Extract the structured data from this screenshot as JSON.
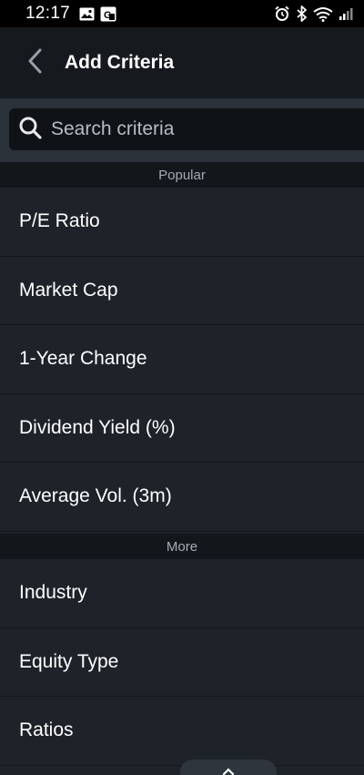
{
  "status_bar": {
    "time": "12:17",
    "left_icons": [
      "image-icon",
      "translate-icon"
    ],
    "right_icons": [
      "alarm-icon",
      "bluetooth-icon",
      "wifi-icon",
      "signal-icon"
    ]
  },
  "header": {
    "title": "Add Criteria",
    "back_icon": "chevron-left-icon"
  },
  "search": {
    "placeholder": "Search criteria",
    "value": ""
  },
  "sections": {
    "popular": {
      "title": "Popular",
      "items": [
        {
          "label": "P/E Ratio"
        },
        {
          "label": "Market Cap"
        },
        {
          "label": "1-Year Change"
        },
        {
          "label": "Dividend Yield (%)"
        },
        {
          "label": "Average Vol. (3m)"
        }
      ]
    },
    "more": {
      "title": "More",
      "items": [
        {
          "label": "Industry"
        },
        {
          "label": "Equity Type"
        },
        {
          "label": "Ratios"
        }
      ]
    }
  },
  "colors": {
    "background": "#1e2329",
    "header_bg": "#161a1f",
    "section_bg": "#13171c",
    "search_field_bg": "#0f1216",
    "text": "#ffffff",
    "muted_text": "#a5abb3"
  }
}
